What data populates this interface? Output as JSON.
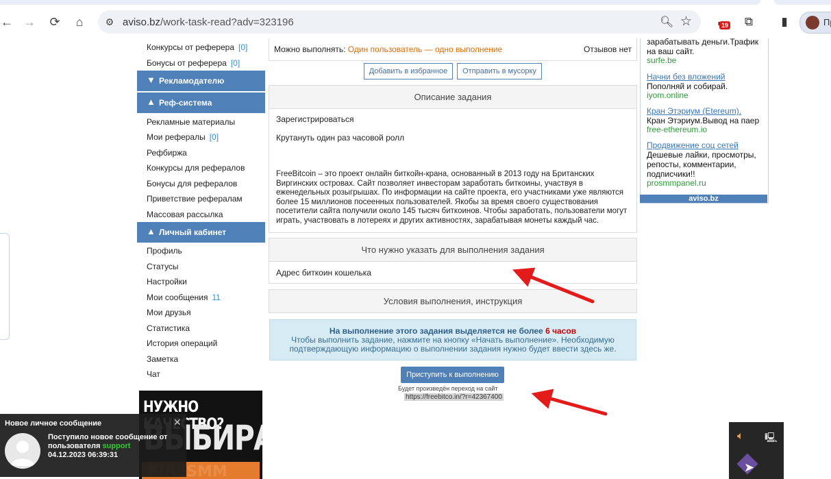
{
  "browser": {
    "url_host": "aviso.bz",
    "url_path": "/work-task-read?adv=323196",
    "extension_badge": "19",
    "profile_label": "Пр"
  },
  "sidebar": {
    "top_links": [
      {
        "label": "Конкурсы от реферера",
        "count": "[0]"
      },
      {
        "label": "Бонусы от реферера",
        "count": "[0]"
      }
    ],
    "sections": {
      "advertiser": "Рекламодателю",
      "ref_system": "Реф-система",
      "cabinet": "Личный кабинет"
    },
    "ref_links": [
      {
        "label": "Рекламные материалы",
        "count": ""
      },
      {
        "label": "Мои рефералы",
        "count": "[0]"
      },
      {
        "label": "Рефбиржа",
        "count": ""
      },
      {
        "label": "Конкурсы для рефералов",
        "count": ""
      },
      {
        "label": "Бонусы для рефералов",
        "count": ""
      },
      {
        "label": "Приветствие рефералам",
        "count": ""
      },
      {
        "label": "Массовая рассылка",
        "count": ""
      }
    ],
    "cabinet_links": [
      {
        "label": "Профиль",
        "count": ""
      },
      {
        "label": "Статусы",
        "count": ""
      },
      {
        "label": "Настройки",
        "count": ""
      },
      {
        "label": "Мои сообщения",
        "count": "11"
      },
      {
        "label": "Мои друзья",
        "count": ""
      },
      {
        "label": "Статистика",
        "count": ""
      },
      {
        "label": "История операций",
        "count": ""
      },
      {
        "label": "Заметка",
        "count": ""
      },
      {
        "label": "Чат",
        "count": ""
      }
    ],
    "promo": {
      "line1": "НУЖНО КАЧЕСТВО?",
      "line2": "ВЫБИРАЙ",
      "line3": "FIRESMM"
    }
  },
  "task": {
    "can_do_label": "Можно выполнять:",
    "can_do_value": "Один пользователь — одно выполнение",
    "reviews": "Отзывов нет",
    "fav_button": "Добавить в избранное",
    "trash_button": "Отправить в мусорку",
    "description_title": "Описание задания",
    "description_line1": "Зарегистрироваться",
    "description_line2": "Крутануть один раз часовой ролл",
    "description_para": "FreeBitcoin – это проект онлайн биткойн-крана, основанный в 2013 году на Британских Виргинских островах. Сайт позволяет инвесторам заработать биткоины, участвуя в еженедельных розыгрышах. По информации на сайте проекта, его участниками уже являются более 15 миллионов посеенных пользователей. Якобы за время своего существования посетители сайта получили около 145 тысяч биткоинов. Чтобы заработать, пользователи могут играть, участвовать в лотереях и других активностях, зарабатывая монеты каждый час.",
    "required_title": "Что нужно указать для выполнения задания",
    "required_value": "Адрес биткоин кошелька",
    "conditions_title": "Условия выполнения, инструкция",
    "time_prefix": "На выполнение этого задания выделяется не более",
    "time_value": "6 часов",
    "time_note": "Чтобы выполнить задание, нажмите на кнопку «Начать выполнение». Необходимую подтверждающую информацию о выполнении задания нужно будет ввести здесь же.",
    "start_button": "Приступить к выполнению",
    "redirect_note": "Будет произведён переход на сайт",
    "redirect_url": "https://freebitco.in/?r=42367400"
  },
  "right_ads": {
    "top_fragment": "зарабатывать деньги.Трафик на ваш сайт.",
    "top_url": "surfe.be",
    "ads": [
      {
        "title": "Начни без вложений",
        "desc": "Пополняй и собирай.",
        "url": "iyom.online"
      },
      {
        "title": "Кран Этэриум (Etereum).",
        "desc": "Кран Этэриум.Вывод на паер",
        "url": "free-ethereum.io"
      },
      {
        "title": "Продвижение соц сетей",
        "desc": "Дешевые лайки, просмотры, репосты, комментарии, подписчики!!",
        "url": "prosmmpanel.ru"
      }
    ],
    "footer": "aviso.bz"
  },
  "notification": {
    "title": "Новое личное сообщение",
    "line1": "Поступило новое сообщение от пользователя",
    "sender": "support",
    "time": "04.12.2023 06:39:31"
  },
  "colors": {
    "accent": "#4f80b8",
    "orange": "#e06c00",
    "red_time": "#cc0000",
    "green_url": "#2e9a3a",
    "arrow": "#e31b1b"
  }
}
